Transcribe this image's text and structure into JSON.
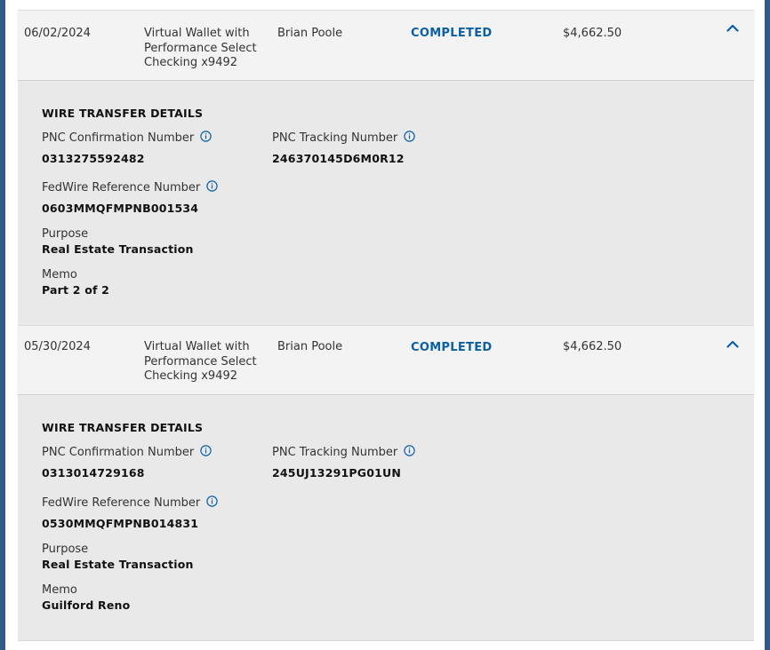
{
  "transactions": [
    {
      "date": "06/02/2024",
      "account": "Virtual Wallet with Performance Select Checking x9492",
      "payee": "Brian Poole",
      "status": "COMPLETED",
      "amount": "$4,662.50",
      "details": {
        "title": "WIRE TRANSFER DETAILS",
        "confirmation_label": "PNC Confirmation Number",
        "confirmation_value": "0313275592482",
        "tracking_label": "PNC Tracking Number",
        "tracking_value": "246370145D6M0R12",
        "fedwire_label": "FedWire Reference Number",
        "fedwire_value": "0603MMQFMPNB001534",
        "purpose_label": "Purpose",
        "purpose_value": "Real Estate Transaction",
        "memo_label": "Memo",
        "memo_value": "Part 2 of 2"
      }
    },
    {
      "date": "05/30/2024",
      "account": "Virtual Wallet with Performance Select Checking x9492",
      "payee": "Brian Poole",
      "status": "COMPLETED",
      "amount": "$4,662.50",
      "details": {
        "title": "WIRE TRANSFER DETAILS",
        "confirmation_label": "PNC Confirmation Number",
        "confirmation_value": "0313014729168",
        "tracking_label": "PNC Tracking Number",
        "tracking_value": "245UJ13291PG01UN",
        "fedwire_label": "FedWire Reference Number",
        "fedwire_value": "0530MMQFMPNB014831",
        "purpose_label": "Purpose",
        "purpose_value": "Real Estate Transaction",
        "memo_label": "Memo",
        "memo_value": "Guilford Reno"
      }
    }
  ],
  "colors": {
    "frame": "#2f5a8a",
    "status": "#0b5fa5",
    "row_bg": "#f3f3f3",
    "details_bg": "#e9e9e9"
  },
  "icons": {
    "expand": "chevron-up-icon",
    "info": "info-icon"
  }
}
